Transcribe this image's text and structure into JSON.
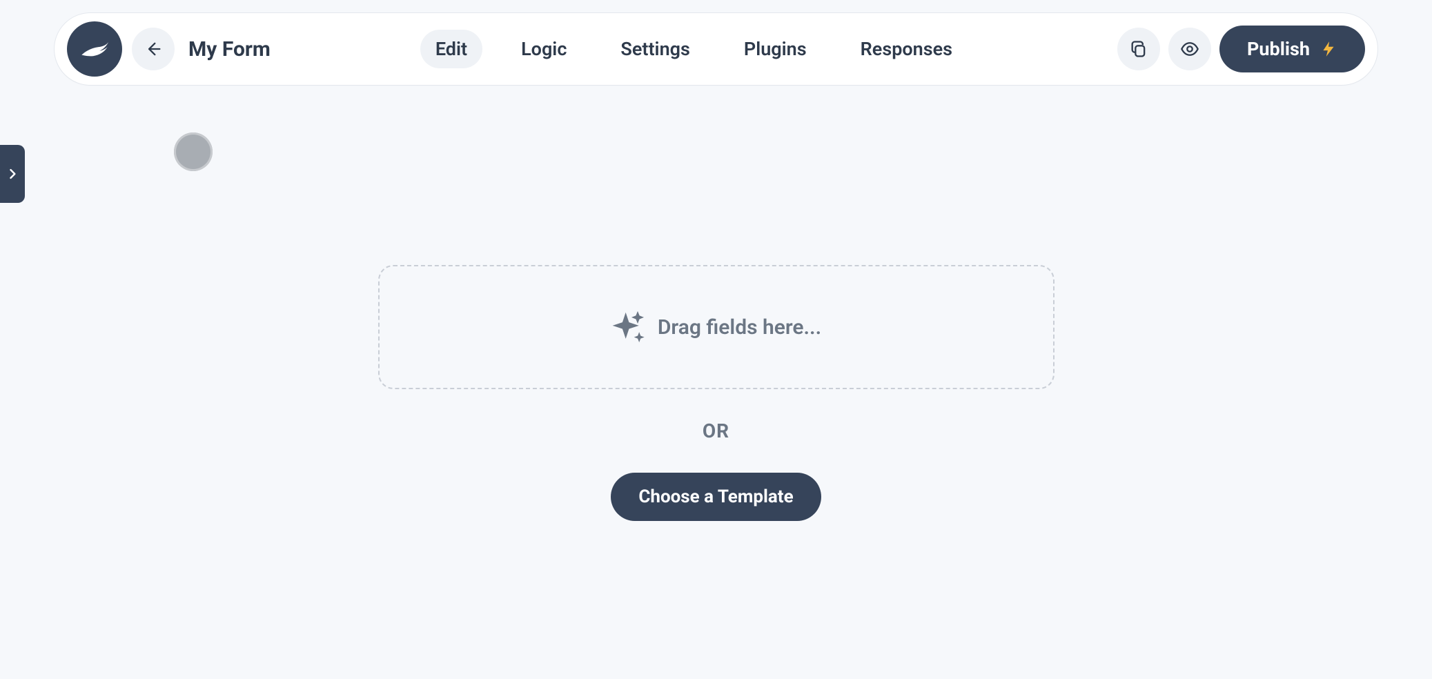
{
  "header": {
    "title": "My Form",
    "tabs": [
      {
        "label": "Edit",
        "active": true
      },
      {
        "label": "Logic",
        "active": false
      },
      {
        "label": "Settings",
        "active": false
      },
      {
        "label": "Plugins",
        "active": false
      },
      {
        "label": "Responses",
        "active": false
      }
    ],
    "publish_label": "Publish"
  },
  "canvas": {
    "dropzone_text": "Drag fields here...",
    "or_text": "OR",
    "template_button": "Choose a Template"
  }
}
